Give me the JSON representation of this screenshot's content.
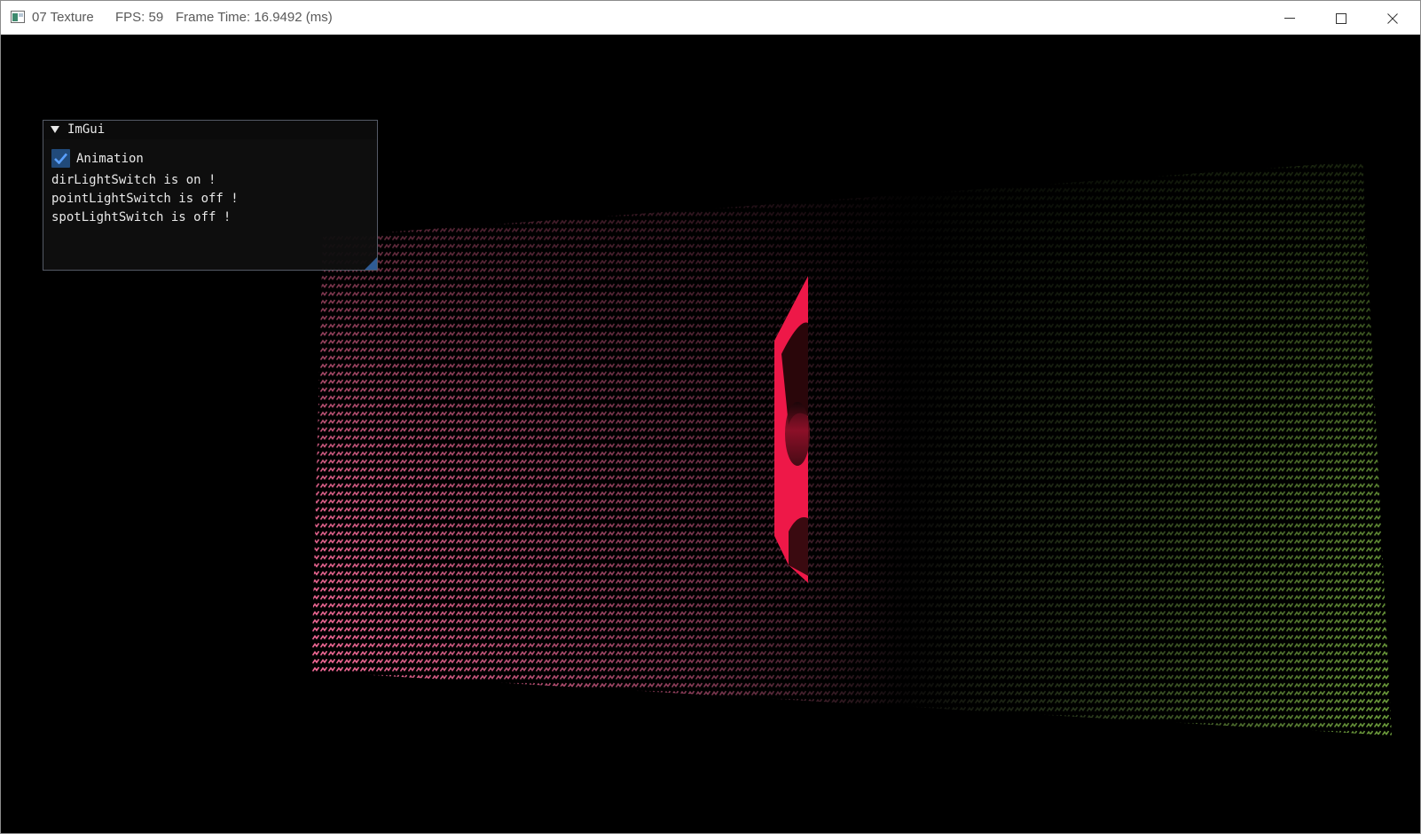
{
  "titlebar": {
    "title": "07 Texture",
    "fps": "FPS: 59",
    "frame_time": "Frame Time: 16.9492 (ms)",
    "icon": "app-window-icon",
    "controls": [
      "minimize-icon",
      "maximize-icon",
      "close-icon"
    ]
  },
  "imgui": {
    "title": "ImGui",
    "collapse_icon": "triangle-down-icon",
    "animation": {
      "label": "Animation",
      "checked": true
    },
    "status": [
      "dirLightSwitch is on !",
      "pointLightSwitch is off !",
      "spotLightSwitch is off !"
    ]
  },
  "scene": {
    "floor_color_near": "#ff6e9e",
    "floor_color_far": "#6e9e3c",
    "picture_tint": "#ee1848"
  }
}
